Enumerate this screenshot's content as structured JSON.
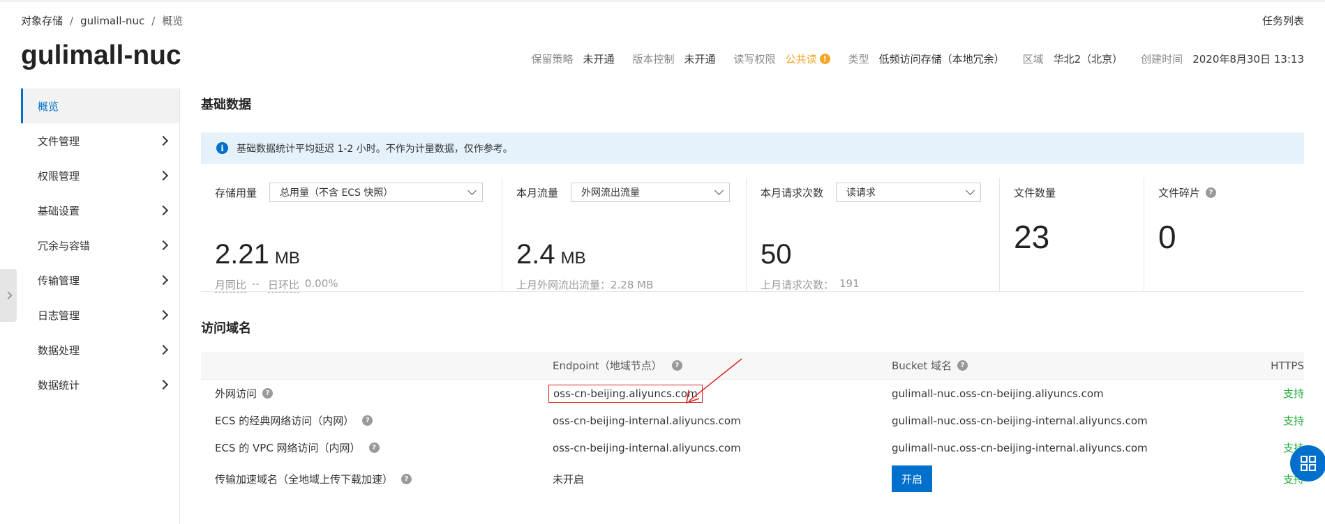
{
  "breadcrumb": {
    "items": [
      "对象存储",
      "gulimall-nuc",
      "概览"
    ],
    "separator": "/"
  },
  "header": {
    "task_list_label": "任务列表",
    "bucket_name": "gulimall-nuc",
    "meta": {
      "retention_label": "保留策略",
      "retention_value": "未开通",
      "versioning_label": "版本控制",
      "versioning_value": "未开通",
      "acl_label": "读写权限",
      "acl_value": "公共读",
      "type_label": "类型",
      "type_value": "低频访问存储（本地冗余）",
      "region_label": "区域",
      "region_value": "华北2（北京）",
      "created_label": "创建时间",
      "created_value": "2020年8月30日 13:13"
    }
  },
  "sidebar": {
    "items": [
      {
        "label": "概览",
        "active": true
      },
      {
        "label": "文件管理"
      },
      {
        "label": "权限管理"
      },
      {
        "label": "基础设置"
      },
      {
        "label": "冗余与容错"
      },
      {
        "label": "传输管理"
      },
      {
        "label": "日志管理"
      },
      {
        "label": "数据处理"
      },
      {
        "label": "数据统计"
      }
    ]
  },
  "basic_data": {
    "title": "基础数据",
    "notice": "基础数据统计平均延迟 1-2 小时。不作为计量数据，仅作参考。",
    "storage": {
      "label": "存储用量",
      "select": "总用量（不含 ECS 快照）",
      "value": "2.21",
      "unit": "MB",
      "mom_label": "月同比",
      "mom_value": "--",
      "dod_label": "日环比",
      "dod_value": "0.00%"
    },
    "traffic": {
      "label": "本月流量",
      "select": "外网流出流量",
      "value": "2.4",
      "unit": "MB",
      "sub": "上月外网流出流量：2.28 MB"
    },
    "requests": {
      "label": "本月请求次数",
      "select": "读请求",
      "value": "50",
      "sub_label": "上月请求次数：",
      "sub_value": "191"
    },
    "files": {
      "label": "文件数量",
      "value": "23"
    },
    "fragments": {
      "label": "文件碎片",
      "value": "0"
    }
  },
  "domains": {
    "title": "访问域名",
    "headers": {
      "endpoint": "Endpoint（地域节点）",
      "bucket_domain": "Bucket 域名",
      "https": "HTTPS"
    },
    "rows": [
      {
        "name": "外网访问",
        "endpoint": "oss-cn-beijing.aliyuncs.com",
        "bucket": "gulimall-nuc.oss-cn-beijing.aliyuncs.com",
        "https": "支持"
      },
      {
        "name": "ECS 的经典网络访问（内网）",
        "endpoint": "oss-cn-beijing-internal.aliyuncs.com",
        "bucket": "gulimall-nuc.oss-cn-beijing-internal.aliyuncs.com",
        "https": "支持"
      },
      {
        "name": "ECS 的 VPC 网络访问（内网）",
        "endpoint": "oss-cn-beijing-internal.aliyuncs.com",
        "bucket": "gulimall-nuc.oss-cn-beijing-internal.aliyuncs.com",
        "https": "支持"
      },
      {
        "name": "传输加速域名（全地域上传下载加速）",
        "endpoint": "未开启",
        "button": "开启",
        "https": "支持"
      }
    ]
  },
  "colors": {
    "accent": "#0070cc",
    "warning": "#f5a623",
    "success": "#22ab39",
    "highlight": "#e02020",
    "info_bg": "#e5f2fc"
  }
}
